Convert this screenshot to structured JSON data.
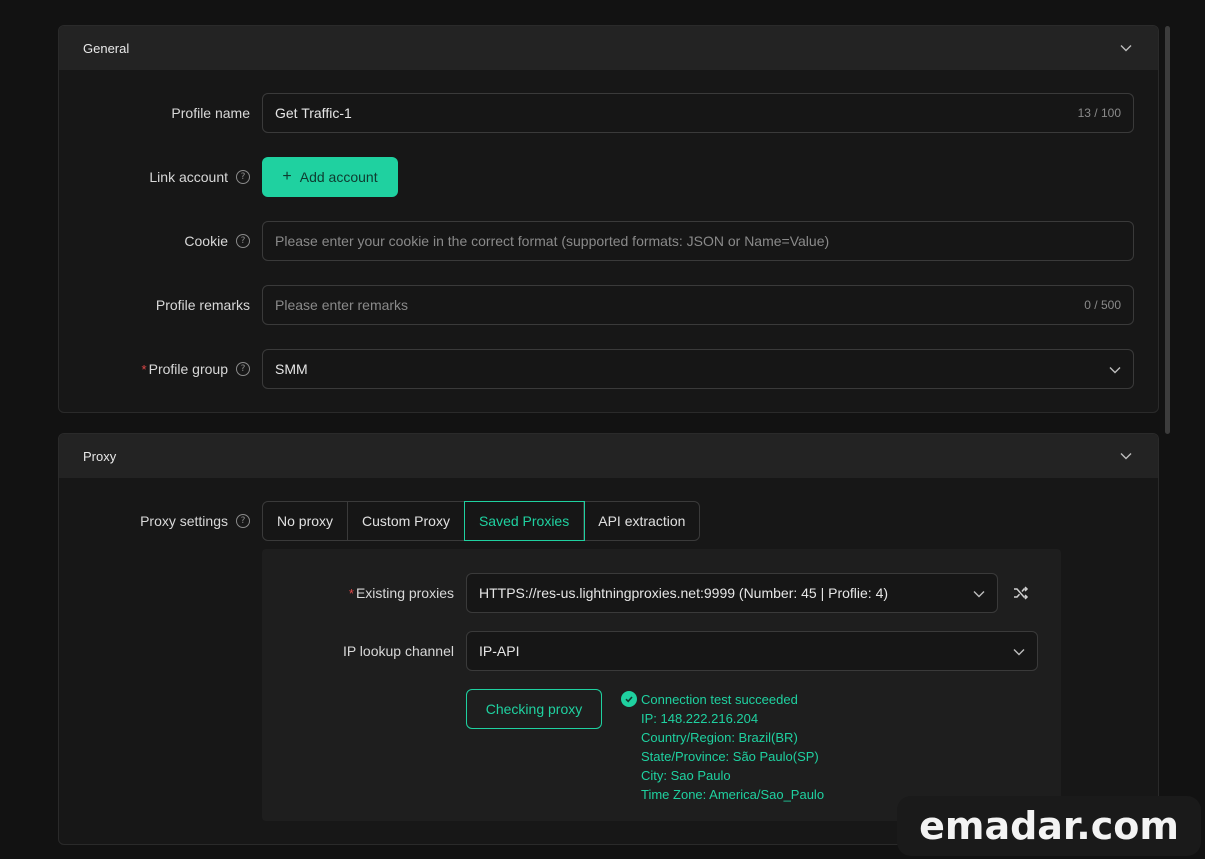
{
  "general": {
    "title": "General",
    "profile_name": {
      "label": "Profile name",
      "value": "Get Traffic-1",
      "counter": "13 / 100"
    },
    "link_account": {
      "label": "Link account",
      "button": "Add account"
    },
    "cookie": {
      "label": "Cookie",
      "placeholder": "Please enter your cookie in the correct format (supported formats: JSON or Name=Value)"
    },
    "remarks": {
      "label": "Profile remarks",
      "placeholder": "Please enter remarks",
      "counter": "0 / 500"
    },
    "group": {
      "label": "Profile group",
      "value": "SMM"
    }
  },
  "proxy": {
    "title": "Proxy",
    "settings_label": "Proxy settings",
    "tabs": [
      "No proxy",
      "Custom Proxy",
      "Saved Proxies",
      "API extraction"
    ],
    "active_tab": "Saved Proxies",
    "existing": {
      "label": "Existing proxies",
      "value": "HTTPS://res-us.lightningproxies.net:9999 (Number: 45 | Proflie: 4)"
    },
    "ip_lookup": {
      "label": "IP lookup channel",
      "value": "IP-API"
    },
    "check_button": "Checking proxy",
    "result": {
      "status": "Connection test succeeded",
      "ip": "IP: 148.222.216.204",
      "country": "Country/Region: Brazil(BR)",
      "state": "State/Province: São Paulo(SP)",
      "city": "City: Sao Paulo",
      "timezone": "Time Zone: America/Sao_Paulo"
    }
  },
  "colors": {
    "accent": "#1fd1a0",
    "required": "#e04848",
    "background": "#121212"
  },
  "watermark": "emadar.com"
}
